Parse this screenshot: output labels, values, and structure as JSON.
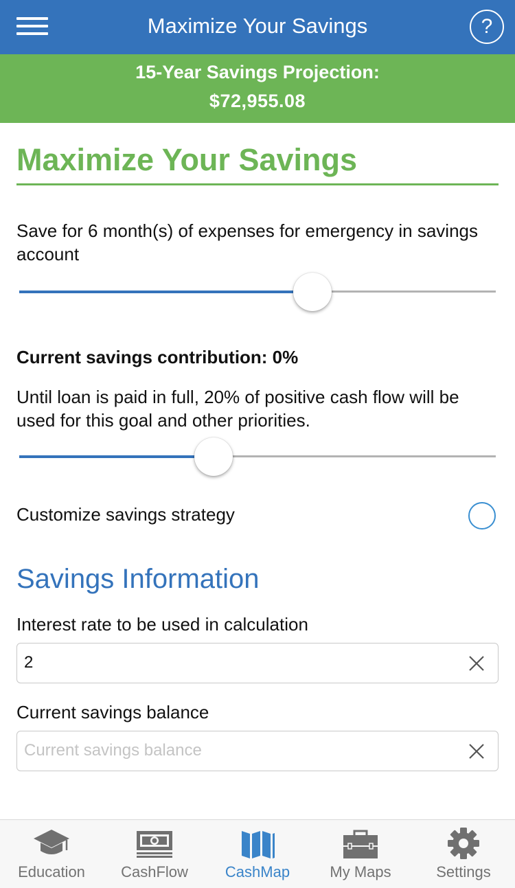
{
  "nav": {
    "title": "Maximize Your Savings",
    "help_icon": "question-mark-circle-icon",
    "menu_icon": "hamburger-menu-icon"
  },
  "banner": {
    "line1": "15-Year Savings Projection:",
    "line2": "$72,955.08"
  },
  "page": {
    "heading": "Maximize Your Savings",
    "emergency_text": "Save for 6 month(s) of expenses for emergency in savings account",
    "emergency_slider_fraction": 0.615,
    "contribution_heading": "Current savings contribution: 0%",
    "contribution_text": "Until loan is paid in full, 20% of positive cash flow will be used for this goal and other priorities.",
    "contribution_slider_fraction": 0.408,
    "customize_label": "Customize savings strategy",
    "customize_selected": false
  },
  "savings_info": {
    "title": "Savings Information",
    "interest_label": "Interest rate to be used in calculation",
    "interest_value": "2",
    "balance_label": "Current savings balance",
    "balance_value": "",
    "balance_placeholder": "Current savings balance"
  },
  "tabs": [
    {
      "label": "Education",
      "icon": "graduation-cap-icon",
      "active": false
    },
    {
      "label": "CashFlow",
      "icon": "money-bill-icon",
      "active": false
    },
    {
      "label": "CashMap",
      "icon": "map-icon",
      "active": true
    },
    {
      "label": "My Maps",
      "icon": "briefcase-icon",
      "active": false
    },
    {
      "label": "Settings",
      "icon": "gear-icon",
      "active": false
    }
  ],
  "colors": {
    "nav_blue": "#3473bb",
    "banner_green": "#6db556",
    "active_tab": "#3a84c9",
    "inactive_tab": "#727272"
  }
}
